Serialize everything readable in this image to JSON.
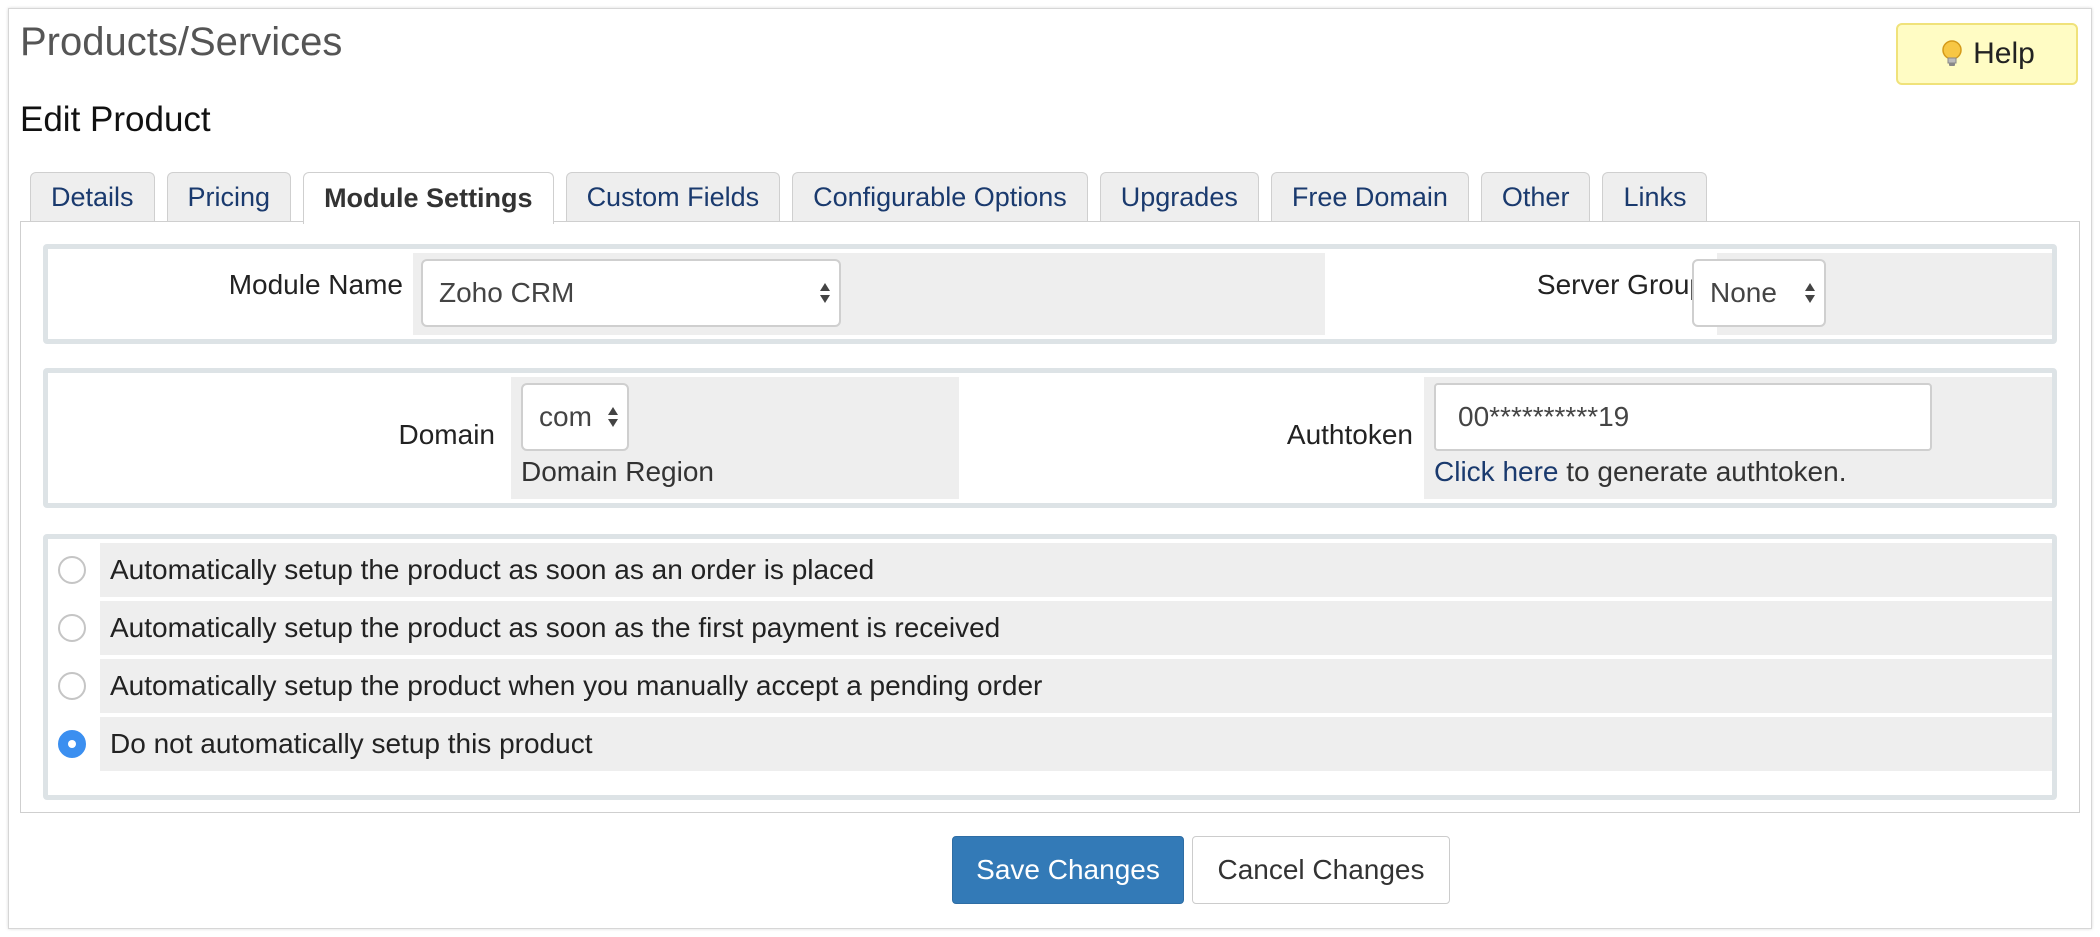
{
  "header": {
    "title": "Products/Services",
    "help_label": "Help",
    "help_icon": "lightbulb-icon"
  },
  "section_title": "Edit Product",
  "tabs": [
    {
      "label": "Details",
      "active": false
    },
    {
      "label": "Pricing",
      "active": false
    },
    {
      "label": "Module Settings",
      "active": true
    },
    {
      "label": "Custom Fields",
      "active": false
    },
    {
      "label": "Configurable Options",
      "active": false
    },
    {
      "label": "Upgrades",
      "active": false
    },
    {
      "label": "Free Domain",
      "active": false
    },
    {
      "label": "Other",
      "active": false
    },
    {
      "label": "Links",
      "active": false
    }
  ],
  "module": {
    "module_name_label": "Module Name",
    "module_name_value": "Zoho CRM",
    "server_group_label": "Server Group",
    "server_group_value": "None"
  },
  "config": {
    "domain_label": "Domain",
    "domain_value": "com",
    "domain_help": "Domain Region",
    "authtoken_label": "Authtoken",
    "authtoken_value": "00**********19",
    "authtoken_link": "Click here",
    "authtoken_help_suffix": " to generate authtoken."
  },
  "setup_options": [
    {
      "label": "Automatically setup the product as soon as an order is placed",
      "checked": false
    },
    {
      "label": "Automatically setup the product as soon as the first payment is received",
      "checked": false
    },
    {
      "label": "Automatically setup the product when you manually accept a pending order",
      "checked": false
    },
    {
      "label": "Do not automatically setup this product",
      "checked": true
    }
  ],
  "actions": {
    "save_label": "Save Changes",
    "cancel_label": "Cancel Changes"
  },
  "colors": {
    "primary": "#337ab7",
    "radio_selected": "#3b8ff0",
    "help_bg": "#fffcc4",
    "link": "#1a3a6e"
  }
}
